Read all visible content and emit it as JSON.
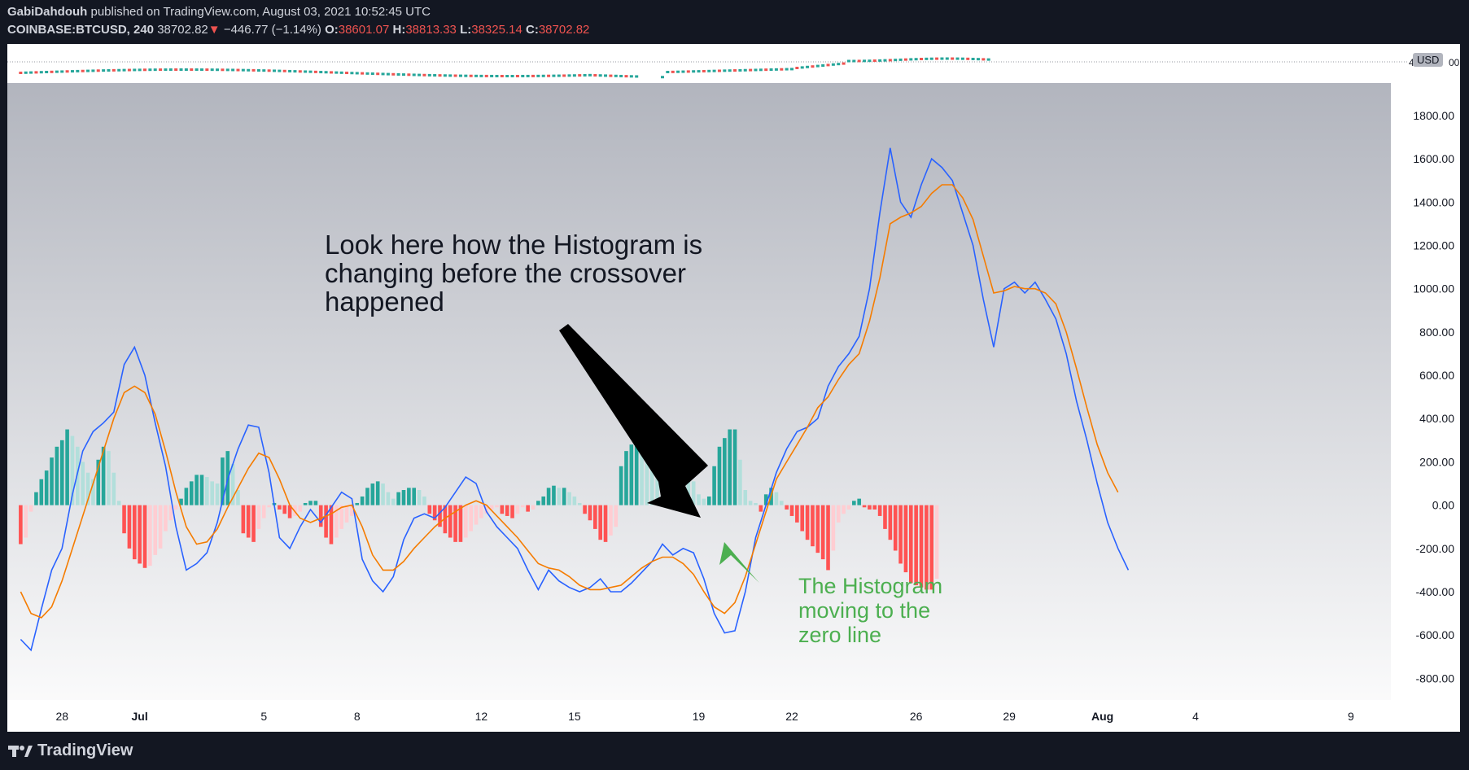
{
  "header": {
    "author": "GabiDahdouh",
    "published": "published on TradingView.com, August 03, 2021 10:52:45 UTC",
    "symbol": "COINBASE:BTCUSD, 240",
    "price": "38702.82",
    "change_arrow": "▼",
    "change": "−446.77 (−1.14%)",
    "o_label": "O:",
    "o": "38601.07",
    "h_label": "H:",
    "h": "38813.33",
    "l_label": "L:",
    "l": "38325.14",
    "c_label": "C:",
    "c": "38702.82"
  },
  "price_pane": {
    "label": "40",
    "unit": "USD",
    "tail": "00"
  },
  "annotations": {
    "main": [
      "Look here how the Histogram is",
      "changing before the crossover",
      "happened"
    ],
    "green": [
      "The Histogram",
      "moving to the",
      "zero line"
    ]
  },
  "footer": {
    "brand": "TradingView",
    "logo": "tradingview-logo-icon"
  },
  "colors": {
    "macd": "#2962ff",
    "signal": "#f57c00",
    "hist_pos_strong": "#26a69a",
    "hist_pos_weak": "#b2dfdb",
    "hist_neg_strong": "#ff5252",
    "hist_neg_weak": "#ffcdd2",
    "annotation_main": "#131722",
    "annotation_green": "#4caf50"
  },
  "chart_data": {
    "type": "line",
    "title": "",
    "ylim": [
      -900,
      1950
    ],
    "yticks": [
      "1800.00",
      "1600.00",
      "1400.00",
      "1200.00",
      "1000.00",
      "800.00",
      "600.00",
      "400.00",
      "200.00",
      "0.00",
      "-200.00",
      "-400.00",
      "-600.00",
      "-800.00"
    ],
    "ytick_values": [
      1800,
      1600,
      1400,
      1200,
      1000,
      800,
      600,
      400,
      200,
      0,
      -200,
      -400,
      -600,
      -800
    ],
    "xticks": [
      "28",
      "Jul",
      "5",
      "8",
      "12",
      "15",
      "19",
      "22",
      "26",
      "29",
      "Aug",
      "4",
      "9"
    ],
    "xtick_bars": [
      8,
      23,
      47,
      65,
      89,
      107,
      131,
      149,
      173,
      191,
      209,
      227,
      257
    ],
    "x_range": [
      -1,
      275
    ],
    "grid": false,
    "series": [
      {
        "key": "macd",
        "points": [
          [
            0,
            -620
          ],
          [
            2,
            -670
          ],
          [
            4,
            -480
          ],
          [
            6,
            -300
          ],
          [
            8,
            -200
          ],
          [
            10,
            50
          ],
          [
            12,
            250
          ],
          [
            14,
            340
          ],
          [
            16,
            380
          ],
          [
            18,
            430
          ],
          [
            20,
            650
          ],
          [
            22,
            730
          ],
          [
            24,
            600
          ],
          [
            26,
            380
          ],
          [
            28,
            180
          ],
          [
            30,
            -100
          ],
          [
            32,
            -300
          ],
          [
            34,
            -270
          ],
          [
            36,
            -220
          ],
          [
            38,
            -80
          ],
          [
            40,
            120
          ],
          [
            42,
            260
          ],
          [
            44,
            370
          ],
          [
            46,
            360
          ],
          [
            48,
            150
          ],
          [
            50,
            -150
          ],
          [
            52,
            -200
          ],
          [
            54,
            -100
          ],
          [
            56,
            -20
          ],
          [
            58,
            -80
          ],
          [
            60,
            -10
          ],
          [
            62,
            60
          ],
          [
            64,
            30
          ],
          [
            66,
            -250
          ],
          [
            68,
            -350
          ],
          [
            70,
            -400
          ],
          [
            72,
            -330
          ],
          [
            74,
            -160
          ],
          [
            76,
            -60
          ],
          [
            78,
            -40
          ],
          [
            80,
            -60
          ],
          [
            82,
            -10
          ],
          [
            84,
            60
          ],
          [
            86,
            130
          ],
          [
            88,
            100
          ],
          [
            90,
            -30
          ],
          [
            92,
            -100
          ],
          [
            94,
            -150
          ],
          [
            96,
            -200
          ],
          [
            98,
            -300
          ],
          [
            100,
            -390
          ],
          [
            102,
            -300
          ],
          [
            104,
            -350
          ],
          [
            106,
            -380
          ],
          [
            108,
            -400
          ],
          [
            110,
            -380
          ],
          [
            112,
            -340
          ],
          [
            114,
            -400
          ],
          [
            116,
            -400
          ],
          [
            118,
            -360
          ],
          [
            120,
            -310
          ],
          [
            122,
            -260
          ],
          [
            124,
            -180
          ],
          [
            126,
            -230
          ],
          [
            128,
            -200
          ],
          [
            130,
            -220
          ],
          [
            132,
            -340
          ],
          [
            134,
            -500
          ],
          [
            136,
            -590
          ],
          [
            138,
            -580
          ],
          [
            140,
            -400
          ],
          [
            142,
            -150
          ],
          [
            144,
            0
          ],
          [
            146,
            150
          ],
          [
            148,
            260
          ],
          [
            150,
            340
          ],
          [
            152,
            360
          ],
          [
            154,
            400
          ],
          [
            156,
            550
          ],
          [
            158,
            640
          ],
          [
            160,
            700
          ],
          [
            162,
            780
          ],
          [
            164,
            1000
          ],
          [
            166,
            1350
          ],
          [
            168,
            1650
          ],
          [
            170,
            1400
          ],
          [
            172,
            1330
          ],
          [
            174,
            1480
          ],
          [
            176,
            1600
          ],
          [
            178,
            1560
          ],
          [
            180,
            1500
          ],
          [
            182,
            1350
          ],
          [
            184,
            1200
          ],
          [
            186,
            950
          ],
          [
            188,
            730
          ],
          [
            190,
            1000
          ],
          [
            192,
            1030
          ],
          [
            194,
            980
          ],
          [
            196,
            1030
          ],
          [
            198,
            950
          ],
          [
            200,
            860
          ],
          [
            202,
            700
          ],
          [
            204,
            480
          ],
          [
            206,
            300
          ],
          [
            208,
            100
          ],
          [
            210,
            -80
          ],
          [
            212,
            -200
          ],
          [
            214,
            -300
          ]
        ]
      },
      {
        "key": "signal",
        "points": [
          [
            0,
            -400
          ],
          [
            2,
            -500
          ],
          [
            4,
            -520
          ],
          [
            6,
            -470
          ],
          [
            8,
            -350
          ],
          [
            10,
            -200
          ],
          [
            12,
            -50
          ],
          [
            14,
            100
          ],
          [
            16,
            250
          ],
          [
            18,
            400
          ],
          [
            20,
            520
          ],
          [
            22,
            550
          ],
          [
            24,
            520
          ],
          [
            26,
            420
          ],
          [
            28,
            250
          ],
          [
            30,
            60
          ],
          [
            32,
            -100
          ],
          [
            34,
            -180
          ],
          [
            36,
            -170
          ],
          [
            38,
            -110
          ],
          [
            40,
            -10
          ],
          [
            42,
            80
          ],
          [
            44,
            170
          ],
          [
            46,
            240
          ],
          [
            48,
            220
          ],
          [
            50,
            120
          ],
          [
            52,
            0
          ],
          [
            54,
            -60
          ],
          [
            56,
            -80
          ],
          [
            58,
            -60
          ],
          [
            60,
            -40
          ],
          [
            62,
            -10
          ],
          [
            64,
            0
          ],
          [
            66,
            -100
          ],
          [
            68,
            -230
          ],
          [
            70,
            -300
          ],
          [
            72,
            -300
          ],
          [
            74,
            -260
          ],
          [
            76,
            -200
          ],
          [
            78,
            -150
          ],
          [
            80,
            -100
          ],
          [
            82,
            -60
          ],
          [
            84,
            -30
          ],
          [
            86,
            0
          ],
          [
            88,
            20
          ],
          [
            90,
            0
          ],
          [
            92,
            -50
          ],
          [
            94,
            -100
          ],
          [
            96,
            -150
          ],
          [
            98,
            -210
          ],
          [
            100,
            -270
          ],
          [
            102,
            -290
          ],
          [
            104,
            -300
          ],
          [
            106,
            -330
          ],
          [
            108,
            -370
          ],
          [
            110,
            -390
          ],
          [
            112,
            -390
          ],
          [
            114,
            -380
          ],
          [
            116,
            -370
          ],
          [
            118,
            -330
          ],
          [
            120,
            -290
          ],
          [
            122,
            -260
          ],
          [
            124,
            -240
          ],
          [
            126,
            -240
          ],
          [
            128,
            -270
          ],
          [
            130,
            -320
          ],
          [
            132,
            -400
          ],
          [
            134,
            -470
          ],
          [
            136,
            -500
          ],
          [
            138,
            -450
          ],
          [
            140,
            -330
          ],
          [
            142,
            -180
          ],
          [
            144,
            -30
          ],
          [
            146,
            120
          ],
          [
            148,
            200
          ],
          [
            150,
            280
          ],
          [
            152,
            360
          ],
          [
            154,
            450
          ],
          [
            156,
            500
          ],
          [
            158,
            580
          ],
          [
            160,
            650
          ],
          [
            162,
            700
          ],
          [
            164,
            850
          ],
          [
            166,
            1050
          ],
          [
            168,
            1300
          ],
          [
            170,
            1330
          ],
          [
            172,
            1350
          ],
          [
            174,
            1380
          ],
          [
            176,
            1440
          ],
          [
            178,
            1480
          ],
          [
            180,
            1480
          ],
          [
            182,
            1420
          ],
          [
            184,
            1320
          ],
          [
            186,
            1150
          ],
          [
            188,
            980
          ],
          [
            190,
            990
          ],
          [
            192,
            1010
          ],
          [
            194,
            1000
          ],
          [
            196,
            1000
          ],
          [
            198,
            980
          ],
          [
            200,
            930
          ],
          [
            202,
            800
          ],
          [
            204,
            630
          ],
          [
            206,
            450
          ],
          [
            208,
            280
          ],
          [
            210,
            150
          ],
          [
            212,
            60
          ]
        ]
      }
    ],
    "histogram": [
      -180,
      -150,
      -30,
      60,
      120,
      160,
      220,
      270,
      300,
      350,
      320,
      270,
      200,
      150,
      120,
      210,
      270,
      250,
      150,
      20,
      -130,
      -200,
      -250,
      -270,
      -290,
      -280,
      -230,
      -200,
      -120,
      -70,
      -20,
      30,
      80,
      110,
      140,
      140,
      130,
      110,
      100,
      220,
      250,
      190,
      70,
      -130,
      -150,
      -170,
      -110,
      -60,
      -10,
      10,
      -20,
      -40,
      -60,
      -50,
      -30,
      10,
      20,
      20,
      -100,
      -150,
      -180,
      -150,
      -110,
      -80,
      -50,
      10,
      40,
      80,
      100,
      110,
      100,
      60,
      30,
      60,
      70,
      80,
      80,
      70,
      40,
      -40,
      -70,
      -100,
      -130,
      -150,
      -170,
      -170,
      -150,
      -120,
      -90,
      -60,
      -40,
      -20,
      -10,
      -40,
      -50,
      -60,
      -40,
      -10,
      -30,
      -20,
      20,
      40,
      80,
      90,
      80,
      80,
      60,
      40,
      10,
      -40,
      -70,
      -110,
      -160,
      -170,
      -140,
      -100,
      180,
      250,
      280,
      280,
      250,
      230,
      220,
      170,
      150,
      110,
      130,
      160,
      170,
      130,
      110,
      50,
      30,
      40,
      180,
      270,
      310,
      350,
      350,
      210,
      70,
      20,
      10,
      -30,
      50,
      80,
      60,
      20,
      -20,
      -50,
      -80,
      -120,
      -160,
      -190,
      -220,
      -250,
      -300,
      -210,
      -80,
      -40,
      -20,
      20,
      30,
      -10,
      -20,
      -20,
      -50,
      -110,
      -160,
      -210,
      -270,
      -310,
      -360,
      -370,
      -380,
      -390,
      -390,
      -340
    ]
  }
}
